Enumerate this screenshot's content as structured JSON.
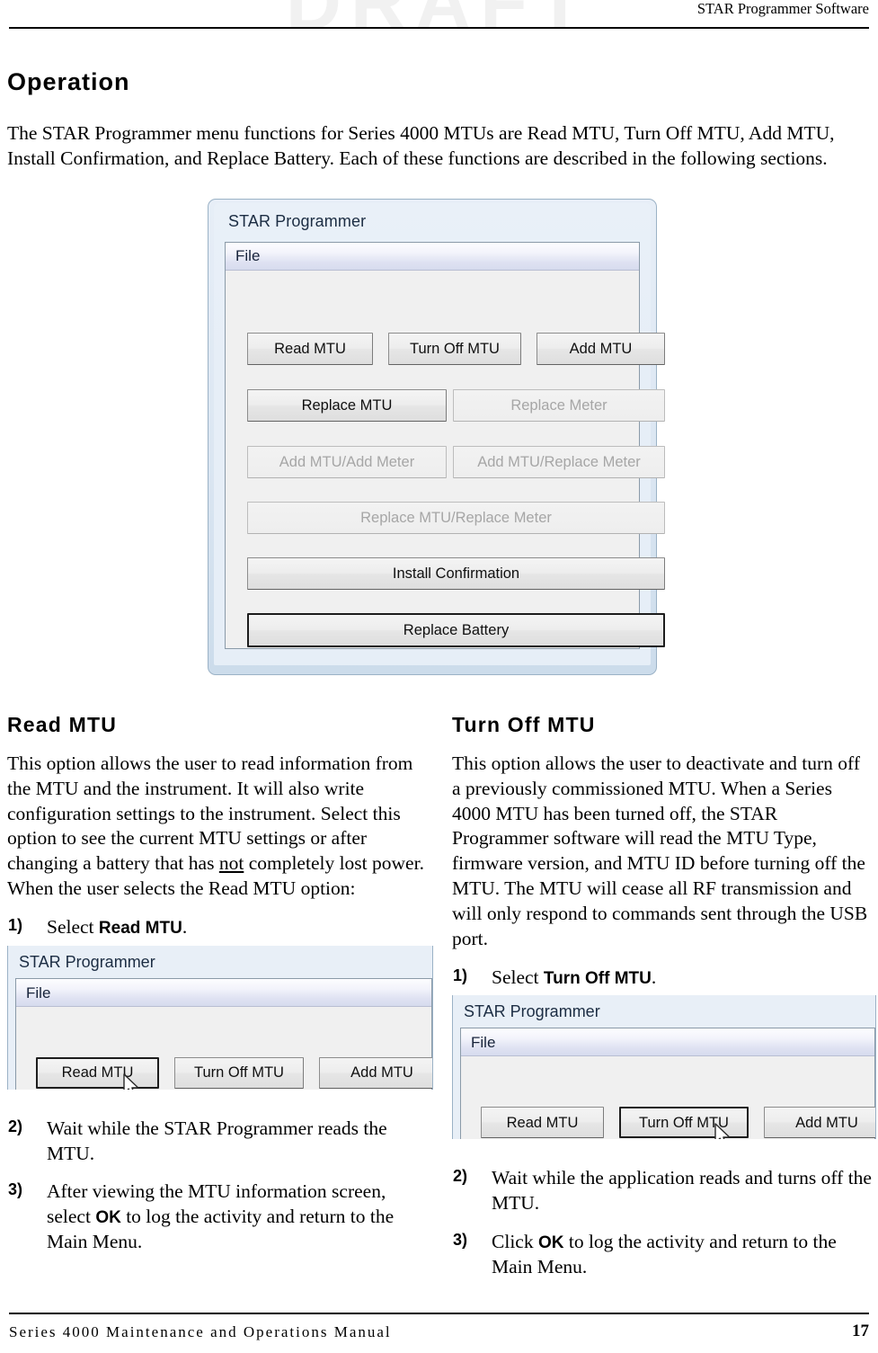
{
  "watermark": "DRAFT",
  "header": {
    "running_head": "STAR Programmer Software"
  },
  "page_title": "Operation",
  "intro_paragraph": "The STAR Programmer menu functions for Series 4000 MTUs are Read MTU, Turn Off MTU, Add MTU, Install Confirmation, and Replace Battery. Each of these functions are described in the following sections.",
  "main_screenshot": {
    "window_title": "STAR Programmer",
    "menu": {
      "file_label": "File"
    },
    "buttons": [
      {
        "label": "Read MTU",
        "state": "enabled"
      },
      {
        "label": "Turn Off MTU",
        "state": "enabled"
      },
      {
        "label": "Add MTU",
        "state": "enabled"
      },
      {
        "label": "Replace MTU",
        "state": "enabled"
      },
      {
        "label": "Replace Meter",
        "state": "disabled"
      },
      {
        "label": "Add MTU/Add Meter",
        "state": "disabled"
      },
      {
        "label": "Add MTU/Replace Meter",
        "state": "disabled"
      },
      {
        "label": "Replace MTU/Replace Meter",
        "state": "disabled"
      },
      {
        "label": "Install Confirmation",
        "state": "enabled"
      },
      {
        "label": "Replace Battery",
        "state": "default"
      }
    ]
  },
  "sections": [
    {
      "heading": "Read MTU",
      "body": "This option allows the user to read information from the MTU and the instrument. It will also write configuration settings to the instrument. Select this option to see the current MTU settings or after changing a battery that has ",
      "body_underlined": "not",
      "body_tail": " completely lost power. When the user selects the Read MTU option:",
      "steps": [
        {
          "num": "1)",
          "pre": "Select ",
          "ui": "Read MTU",
          "post": "."
        },
        {
          "num": "2)",
          "pre": "Wait while the STAR Programmer reads the MTU.",
          "ui": "",
          "post": ""
        },
        {
          "num": "3)",
          "pre": "After viewing the MTU information screen, select ",
          "ui": "OK",
          "post": " to log the activity and return to the Main Menu."
        }
      ],
      "inset": {
        "window_title": "STAR Programmer",
        "menu": {
          "file_label": "File"
        },
        "buttons": [
          {
            "label": "Read MTU",
            "state": "focused"
          },
          {
            "label": "Turn Off MTU",
            "state": "enabled"
          },
          {
            "label": "Add MTU",
            "state": "enabled"
          }
        ],
        "cursor_on": "Read MTU"
      }
    },
    {
      "heading": "Turn Off MTU",
      "body": "This option allows the user to deactivate and turn off a previously commissioned MTU. When a Series 4000 MTU has been turned off, the STAR Programmer software will read the MTU Type, firmware version, and MTU ID before turning off the MTU. The MTU will cease all RF transmission and will only respond to commands sent through the USB port.",
      "body_underlined": "",
      "body_tail": "",
      "steps": [
        {
          "num": "1)",
          "pre": "Select ",
          "ui": "Turn Off MTU",
          "post": "."
        },
        {
          "num": "2)",
          "pre": "Wait while the application reads and turns off the MTU.",
          "ui": "",
          "post": ""
        },
        {
          "num": "3)",
          "pre": "Click ",
          "ui": "OK",
          "post": " to log the activity and return to the Main Menu."
        }
      ],
      "inset": {
        "window_title": "STAR Programmer",
        "menu": {
          "file_label": "File"
        },
        "buttons": [
          {
            "label": "Read MTU",
            "state": "enabled"
          },
          {
            "label": "Turn Off MTU",
            "state": "focused"
          },
          {
            "label": "Add MTU",
            "state": "enabled"
          }
        ],
        "cursor_on": "Turn Off MTU"
      }
    }
  ],
  "footer": {
    "manual_title": "Series 4000 Maintenance and Operations Manual",
    "page_number": "17"
  }
}
